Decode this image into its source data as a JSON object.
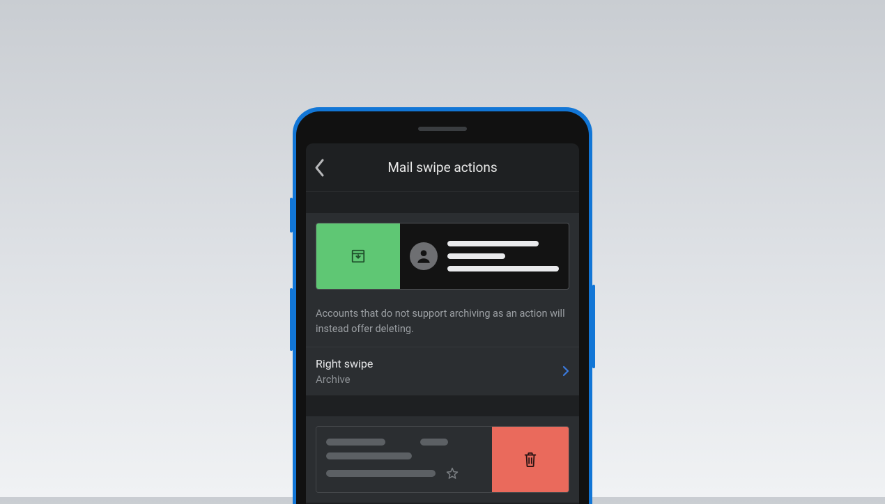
{
  "header": {
    "title": "Mail swipe actions"
  },
  "colors": {
    "swipe_green": "#5fc774",
    "swipe_red": "#ea6a5c",
    "accent_blue": "#3b7be0"
  },
  "right_swipe": {
    "preview_icon": "archive-icon",
    "hint": "Accounts that do not support archiving as an action will instead offer deleting.",
    "label": "Right swipe",
    "value": "Archive"
  },
  "left_swipe": {
    "preview_icon": "trash-icon"
  }
}
